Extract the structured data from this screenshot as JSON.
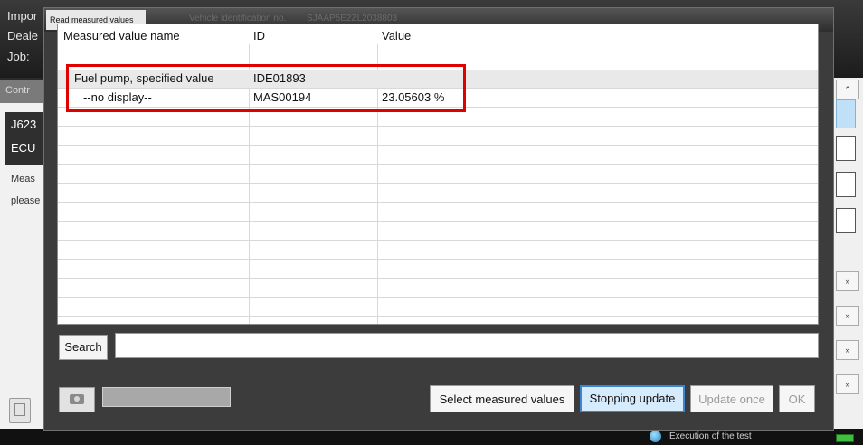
{
  "background": {
    "header_labels": [
      "Impor",
      "Deale",
      "Job:"
    ],
    "control_label": "Contr",
    "ecu_labels": [
      "J623",
      "ECU"
    ],
    "left_texts": [
      "Meas",
      "please"
    ],
    "right_buttons": [
      "»",
      "»",
      "»",
      "»",
      "»"
    ],
    "status_text": "Execution of the test"
  },
  "dialog": {
    "title": "Read measured values",
    "vin_label": "Vehicle identification no.",
    "vin_value": "SJAAP5E2ZL2038803",
    "table": {
      "headers": {
        "name": "Measured value name",
        "id": "ID",
        "value": "Value"
      },
      "rows": [
        {
          "name": "Fuel pump, specified value",
          "id": "IDE01893",
          "value": ""
        },
        {
          "name": "--no display--",
          "id": "MAS00194",
          "value": "23.05603 %"
        }
      ]
    },
    "search": {
      "button_label": "Search",
      "value": ""
    },
    "buttons": {
      "select_measured_values": "Select measured values",
      "stopping_update": "Stopping update",
      "update_once": "Update once",
      "ok": "OK"
    },
    "icons": {
      "camera": "camera-icon"
    }
  }
}
